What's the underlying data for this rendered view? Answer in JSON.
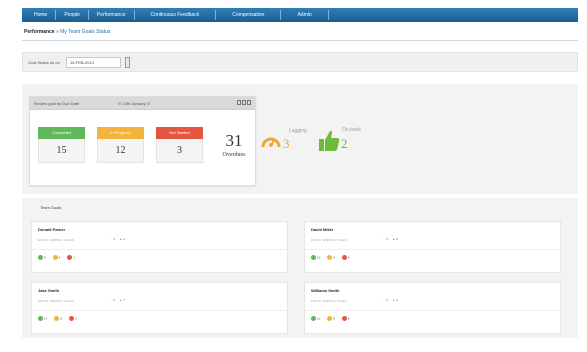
{
  "nav": {
    "tabs": [
      "Home",
      "People",
      "Performance",
      "Continuous Feedback",
      "Compensation",
      "Admin"
    ]
  },
  "breadcrumb": {
    "main": "Performance",
    "sub": " » My Team Goals Status"
  },
  "filter": {
    "label": "Goal Status as on",
    "date": "16-FEB-2014"
  },
  "review": {
    "header_title": "Review goal by Due Date",
    "header_date": "⊙ 10th January ⊙",
    "statuses": [
      {
        "label": "Completed",
        "value": "15",
        "color": "#5fb85a"
      },
      {
        "label": "In Progress",
        "value": "12",
        "color": "#f3b33d"
      },
      {
        "label": "Not Started",
        "value": "3",
        "color": "#e4563f"
      }
    ],
    "overdue": {
      "value": "31",
      "label": "Overdues"
    }
  },
  "indicators": {
    "lagging": {
      "label": "Lagging",
      "value": "3",
      "color": "#f0a830"
    },
    "ontrack": {
      "label": "On track",
      "value": "2",
      "color": "#6cbb3c"
    }
  },
  "team_goals": {
    "title": "Team Goals",
    "members": [
      {
        "name": "Donald Parker",
        "emp": "EMP ID: EMP002 | SALES",
        "lag": "2",
        "ok": "3",
        "green": "8",
        "yellow": "4",
        "red": "1"
      },
      {
        "name": "David Miller",
        "emp": "EMP ID: EMP002 | SALES",
        "lag": "0",
        "ok": "6",
        "green": "12",
        "yellow": "8",
        "red": "6"
      },
      {
        "name": "Jake Smith",
        "emp": "EMP ID: EMP002 | SALES",
        "lag": "4",
        "ok": "7",
        "green": "17",
        "yellow": "8",
        "red": "3"
      },
      {
        "name": "Williams Smith",
        "emp": "EMP ID: EMP002 | SALES",
        "lag": "0",
        "ok": "4",
        "green": "11",
        "yellow": "8",
        "red": "6"
      }
    ]
  },
  "colors": {
    "nav": "#1b5e91",
    "link": "#2a6ea8",
    "dot_green": "#5fb85a",
    "dot_yellow": "#f3b33d",
    "dot_red": "#e4563f"
  }
}
